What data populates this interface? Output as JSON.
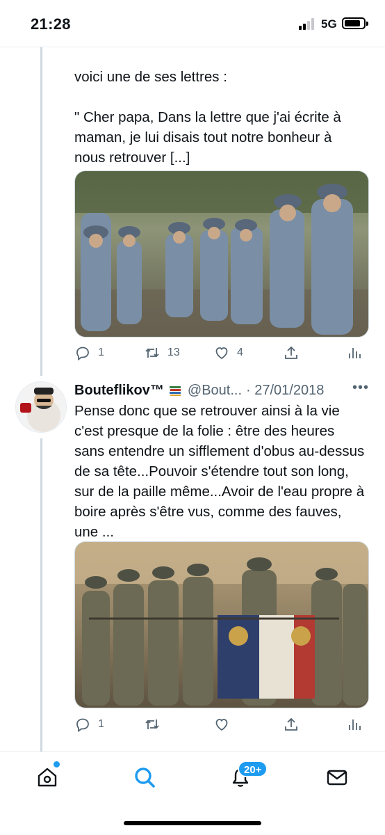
{
  "status_bar": {
    "time": "21:28",
    "network": "5G"
  },
  "tweet1": {
    "text": "voici une de ses lettres :\n\n\" Cher papa, Dans la lettre que j'ai écrite à maman, je lui disais tout notre bonheur à nous retrouver [...]",
    "image_icon": "photo-soldiers-trench",
    "actions": {
      "reply_count": "1",
      "retweet_count": "13",
      "like_count": "4"
    }
  },
  "tweet2": {
    "author_name": "Bouteflikov™",
    "author_emoji": "books-emoji",
    "handle": "@Bout...",
    "date": "· 27/01/2018",
    "more": "•••",
    "text": "Pense donc que se retrouver ainsi à la vie c'est presque de la folie : être des heures sans entendre un sifflement d'obus au-dessus de sa tête...Pouvoir s'étendre tout son long, sur de la paille même...Avoir de l'eau propre à boire après s'être vus, comme des fauves, une ...",
    "image_icon": "photo-soldiers-flag",
    "actions": {
      "reply_count": "1",
      "retweet_count": "",
      "like_count": ""
    }
  },
  "tabbar": {
    "notifications_badge": "20+"
  },
  "colors": {
    "accent": "#1d9bf0",
    "text": "#0f1419",
    "secondary": "#536471"
  }
}
